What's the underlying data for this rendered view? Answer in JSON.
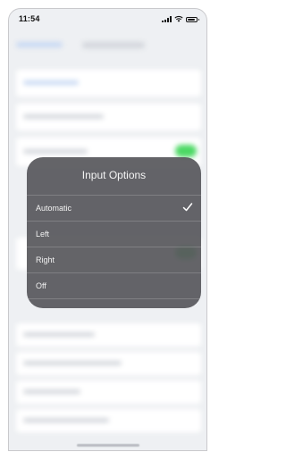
{
  "status_bar": {
    "time": "11:54"
  },
  "modal": {
    "title": "Input Options",
    "options": [
      {
        "label": "Automatic",
        "selected": true
      },
      {
        "label": "Left",
        "selected": false
      },
      {
        "label": "Right",
        "selected": false
      },
      {
        "label": "Off",
        "selected": false
      }
    ]
  },
  "colors": {
    "modal_background": "#58585c",
    "toggle_on": "#4cd964",
    "text": "#ffffff"
  }
}
